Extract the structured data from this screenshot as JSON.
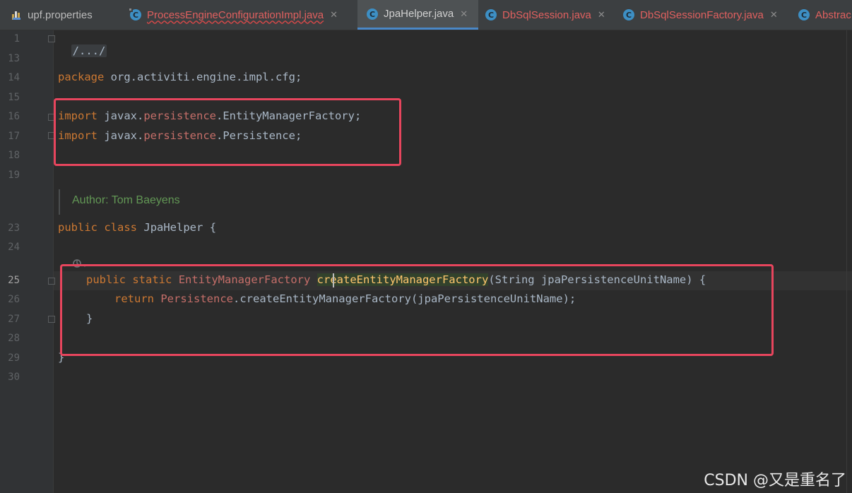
{
  "tabs": [
    {
      "label": "upf.properties",
      "icon": "properties-file-icon",
      "state": "normal",
      "closable": false
    },
    {
      "label": "ProcessEngineConfigurationImpl.java",
      "icon": "java-class-icon",
      "state": "error",
      "closable": true
    },
    {
      "label": "JpaHelper.java",
      "icon": "java-class-icon",
      "state": "active",
      "closable": true
    },
    {
      "label": "DbSqlSession.java",
      "icon": "java-class-icon",
      "state": "normal",
      "closable": true
    },
    {
      "label": "DbSqlSessionFactory.java",
      "icon": "java-class-icon",
      "state": "error",
      "closable": true
    },
    {
      "label": "Abstrac",
      "icon": "java-class-icon",
      "state": "error",
      "closable": false
    }
  ],
  "close_glyph": "✕",
  "gutter": {
    "line_numbers": [
      "1",
      "13",
      "14",
      "15",
      "16",
      "17",
      "18",
      "19",
      "23",
      "24",
      "25",
      "26",
      "27",
      "28",
      "29",
      "30"
    ],
    "current_line": "25"
  },
  "code": {
    "fold_header": "/.../",
    "package_line": {
      "kw": "package",
      "rest": " org.activiti.engine.impl.cfg;"
    },
    "import1": {
      "kw": "import",
      "pre": " javax.",
      "pkg": "persistence",
      "post": ".EntityManagerFactory;"
    },
    "import2": {
      "kw": "import",
      "pre": " javax.",
      "pkg": "persistence",
      "post": ".Persistence;"
    },
    "doc_author": "Author: Tom Baeyens",
    "class_decl": {
      "kw1": "public",
      "kw2": "class",
      "name": "JpaHelper",
      "brace": " {"
    },
    "method_decl": {
      "kw1": "public",
      "kw2": "static",
      "type": "EntityManagerFactory",
      "name": "createEntityManagerFactory",
      "params": "(String jpaPersistenceUnitName) {"
    },
    "return_line": {
      "kw": "return",
      "cls": "Persistence",
      "rest": ".createEntityManagerFactory(jpaPersistenceUnitName);"
    },
    "close_method": "}",
    "close_class": "}"
  },
  "annotations": {
    "box_color": "#e7455d"
  },
  "watermark": "CSDN @又是重名了"
}
